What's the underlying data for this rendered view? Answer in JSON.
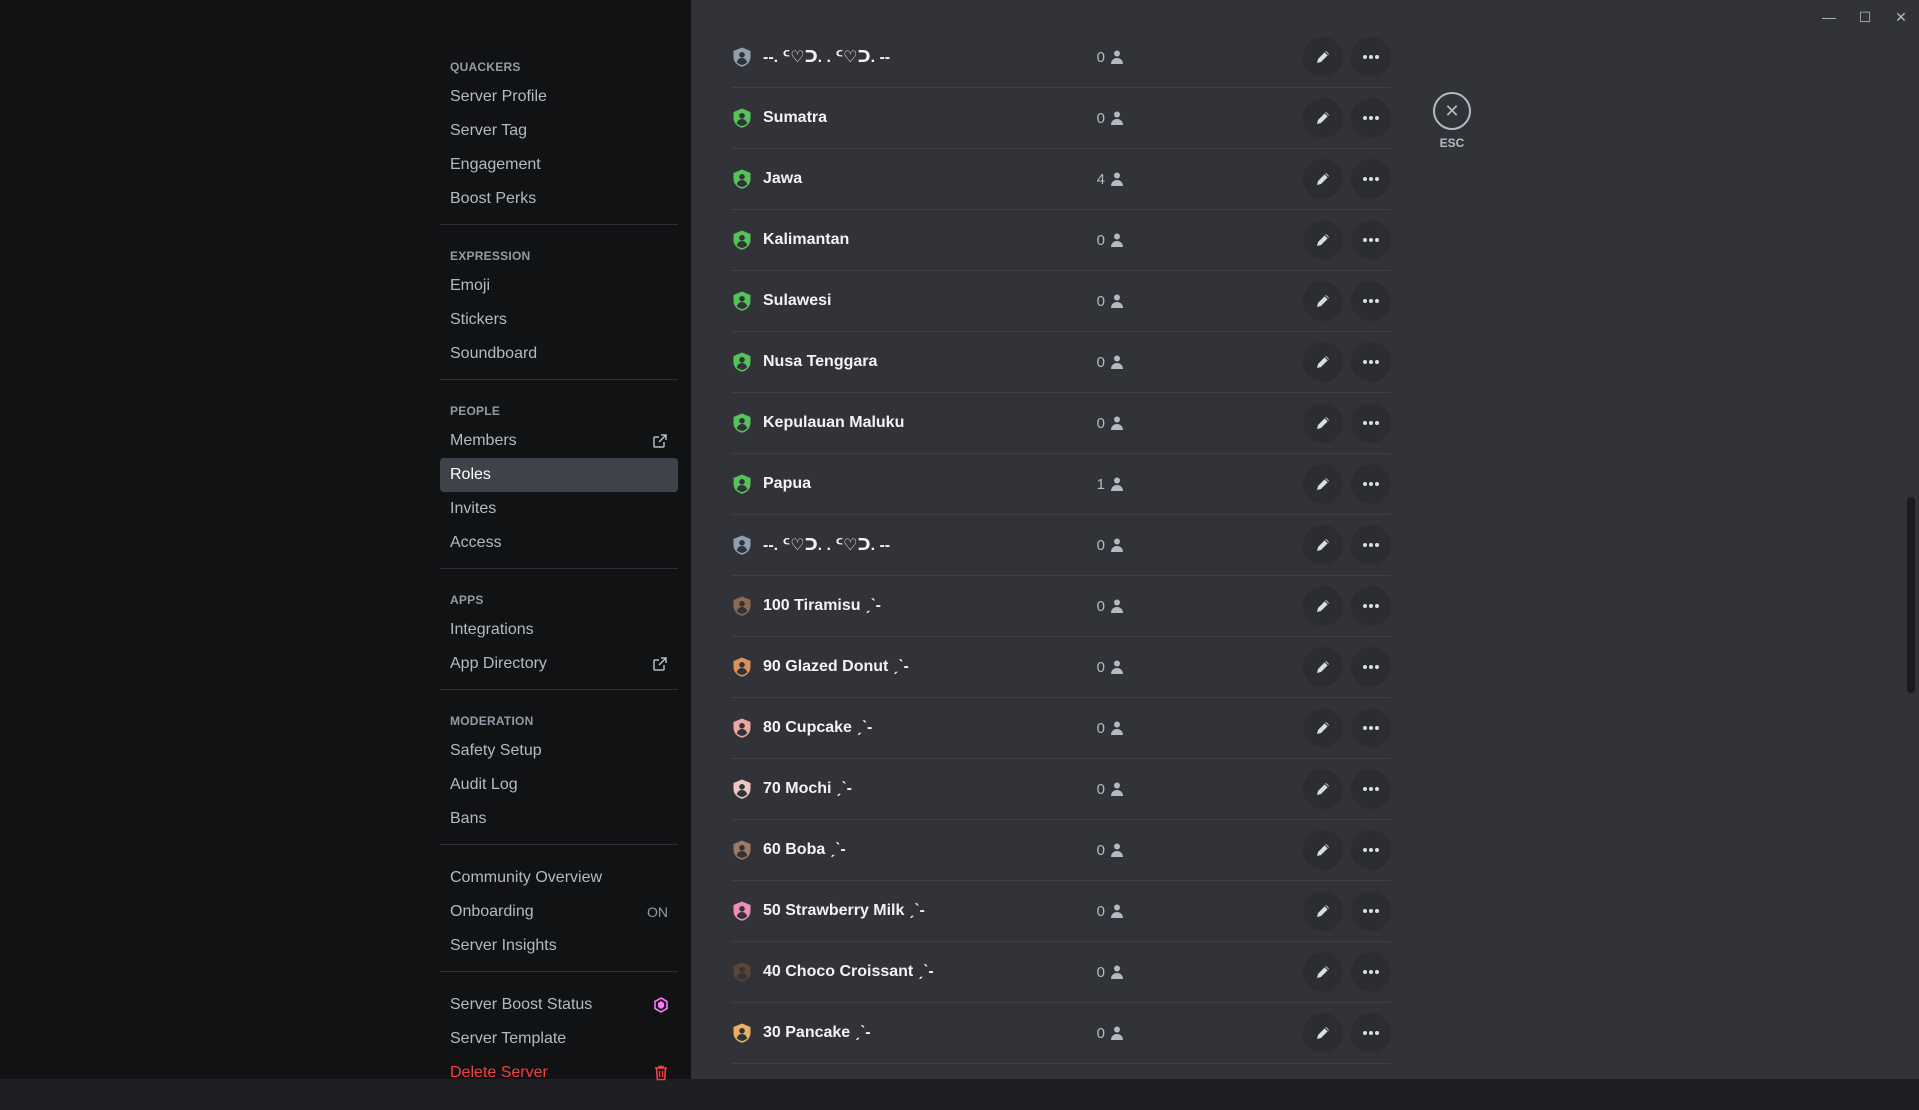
{
  "sidebar": {
    "sections": [
      {
        "header": "Quackers",
        "items": [
          {
            "label": "Server Profile"
          },
          {
            "label": "Server Tag"
          },
          {
            "label": "Engagement"
          },
          {
            "label": "Boost Perks"
          }
        ]
      },
      {
        "header": "Expression",
        "items": [
          {
            "label": "Emoji"
          },
          {
            "label": "Stickers"
          },
          {
            "label": "Soundboard"
          }
        ]
      },
      {
        "header": "People",
        "items": [
          {
            "label": "Members",
            "icon": "external-link-icon"
          },
          {
            "label": "Roles",
            "active": true
          },
          {
            "label": "Invites"
          },
          {
            "label": "Access"
          }
        ]
      },
      {
        "header": "Apps",
        "items": [
          {
            "label": "Integrations"
          },
          {
            "label": "App Directory",
            "icon": "external-link-icon"
          }
        ]
      },
      {
        "header": "Moderation",
        "items": [
          {
            "label": "Safety Setup"
          },
          {
            "label": "Audit Log"
          },
          {
            "label": "Bans"
          }
        ]
      },
      {
        "header": "",
        "items": [
          {
            "label": "Community Overview"
          },
          {
            "label": "Onboarding",
            "badge": "ON"
          },
          {
            "label": "Server Insights"
          }
        ]
      },
      {
        "header": "",
        "items": [
          {
            "label": "Server Boost Status",
            "icon": "boost-gem-icon"
          },
          {
            "label": "Server Template"
          },
          {
            "label": "Delete Server",
            "icon": "trash-icon",
            "danger": true
          }
        ]
      }
    ]
  },
  "roles": [
    {
      "name": "--. ᑦ♡ᑐ. . ᑦ♡ᑐ. --",
      "count": "0",
      "color": "#8ea0b0"
    },
    {
      "name": "Sumatra",
      "count": "0",
      "color": "#57c25a"
    },
    {
      "name": "Jawa",
      "count": "4",
      "color": "#57c25a"
    },
    {
      "name": "Kalimantan",
      "count": "0",
      "color": "#57c25a"
    },
    {
      "name": "Sulawesi",
      "count": "0",
      "color": "#57c25a"
    },
    {
      "name": "Nusa Tenggara",
      "count": "0",
      "color": "#57c25a"
    },
    {
      "name": "Kepulauan Maluku",
      "count": "0",
      "color": "#57c25a"
    },
    {
      "name": "Papua",
      "count": "1",
      "color": "#57c25a"
    },
    {
      "name": "--. ᑦ♡ᑐ. . ᑦ♡ᑐ. --",
      "count": "0",
      "color": "#8ea0b0"
    },
    {
      "name": "100 Tiramisu ˏˋ-",
      "count": "0",
      "color": "#8b6a55"
    },
    {
      "name": "90 Glazed Donut ˏˋ-",
      "count": "0",
      "color": "#d9925a"
    },
    {
      "name": "80 Cupcake ˏˋ-",
      "count": "0",
      "color": "#e8a8a0"
    },
    {
      "name": "70 Mochi ˏˋ-",
      "count": "0",
      "color": "#f0c6c0"
    },
    {
      "name": "60 Boba ˏˋ-",
      "count": "0",
      "color": "#9c7a66"
    },
    {
      "name": "50 Strawberry Milk ˏˋ-",
      "count": "0",
      "color": "#f08cb8"
    },
    {
      "name": "40 Choco Croissant ˏˋ-",
      "count": "0",
      "color": "#5c4536"
    },
    {
      "name": "30 Pancake ˏˋ-",
      "count": "0",
      "color": "#e8b060"
    }
  ],
  "esc": {
    "label": "ESC"
  }
}
